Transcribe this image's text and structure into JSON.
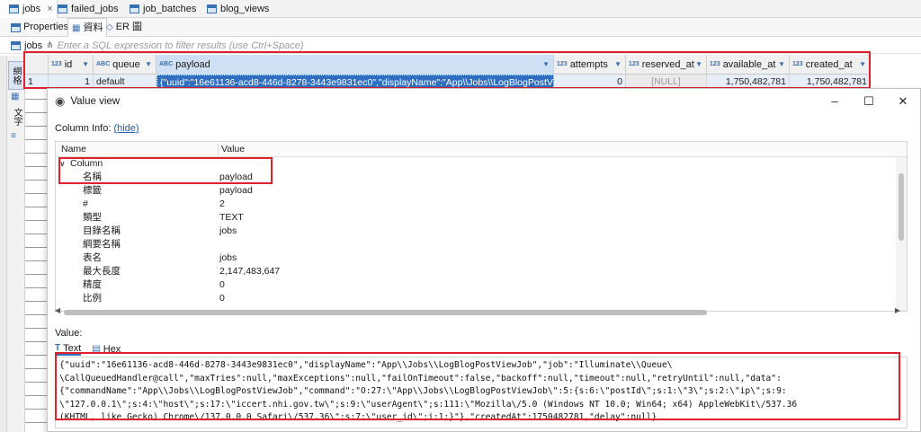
{
  "editor_tabs": [
    {
      "label": "jobs",
      "active": true
    },
    {
      "label": "failed_jobs",
      "active": false
    },
    {
      "label": "job_batches",
      "active": false
    },
    {
      "label": "blog_views",
      "active": false
    }
  ],
  "close_glyph": "×",
  "sub_tabs": [
    {
      "label": "Properties",
      "icon": "properties-icon"
    },
    {
      "label": "資料",
      "icon": "data-grid-icon"
    },
    {
      "label": "ER 圖",
      "icon": "er-diagram-icon"
    }
  ],
  "filter": {
    "table": "jobs",
    "placeholder": "Enter a SQL expression to filter results (use Ctrl+Space)"
  },
  "side_tabs": [
    "網格",
    "文字"
  ],
  "grid": {
    "columns": [
      {
        "type": "123",
        "name": "id"
      },
      {
        "type": "ABC",
        "name": "queue"
      },
      {
        "type": "ABC",
        "name": "payload"
      },
      {
        "type": "123",
        "name": "attempts"
      },
      {
        "type": "123",
        "name": "reserved_at"
      },
      {
        "type": "123",
        "name": "available_at"
      },
      {
        "type": "123",
        "name": "created_at"
      }
    ],
    "row": {
      "row_number": "1",
      "id": "1",
      "queue": "default",
      "payload": "{\"uuid\":\"16e61136-acd8-446d-8278-3443e9831ec0\",\"displayName\":\"App\\\\Jobs\\\\LogBlogPostViewJol",
      "attempts": "0",
      "reserved_at": "[NULL]",
      "available_at": "1,750,482,781",
      "created_at": "1,750,482,781"
    }
  },
  "value_view": {
    "title": "Value view",
    "column_info_label": "Column Info:",
    "hide_link": "(hide)",
    "table_headers": {
      "name": "Name",
      "value": "Value"
    },
    "group_label": "Column",
    "properties": [
      {
        "key": "名稱",
        "value": "payload"
      },
      {
        "key": "標籤",
        "value": "payload"
      },
      {
        "key": "#",
        "value": "2"
      },
      {
        "key": "類型",
        "value": "TEXT"
      },
      {
        "key": "目錄名稱",
        "value": "jobs"
      },
      {
        "key": "綱要名稱",
        "value": ""
      },
      {
        "key": "表名",
        "value": "jobs"
      },
      {
        "key": "最大長度",
        "value": "2,147,483,647"
      },
      {
        "key": "精度",
        "value": "0"
      },
      {
        "key": "比例",
        "value": "0"
      }
    ],
    "value_label": "Value:",
    "value_tabs": [
      "Text",
      "Hex"
    ],
    "text_lines": [
      "{\"uuid\":\"16e61136-acd8-446d-8278-3443e9831ec0\",\"displayName\":\"App\\\\Jobs\\\\LogBlogPostViewJob\",\"job\":\"Illuminate\\\\Queue\\",
      "\\CallQueuedHandler@call\",\"maxTries\":null,\"maxExceptions\":null,\"failOnTimeout\":false,\"backoff\":null,\"timeout\":null,\"retryUntil\":null,\"data\":",
      "{\"commandName\":\"App\\\\Jobs\\\\LogBlogPostViewJob\",\"command\":\"O:27:\\\"App\\\\Jobs\\\\LogBlogPostViewJob\\\":5:{s:6:\\\"postId\\\";s:1:\\\"3\\\";s:2:\\\"ip\\\";s:9:",
      "\\\"127.0.0.1\\\";s:4:\\\"host\\\";s:17:\\\"iccert.nhi.gov.tw\\\";s:9:\\\"userAgent\\\";s:111:\\\"Mozilla\\/5.0 (Windows NT 10.0; Win64; x64) AppleWebKit\\/537.36",
      "(KHTML, like Gecko) Chrome\\/137.0.0.0 Safari\\/537.36\\\";s:7:\\\"user_id\\\";i:1;}\"},\"createdAt\":1750482781,\"delay\":null}"
    ]
  },
  "colors": {
    "highlight_red": "#e0202c",
    "selection_blue": "#2f6fc1",
    "type_blue": "#3a6fb0"
  }
}
